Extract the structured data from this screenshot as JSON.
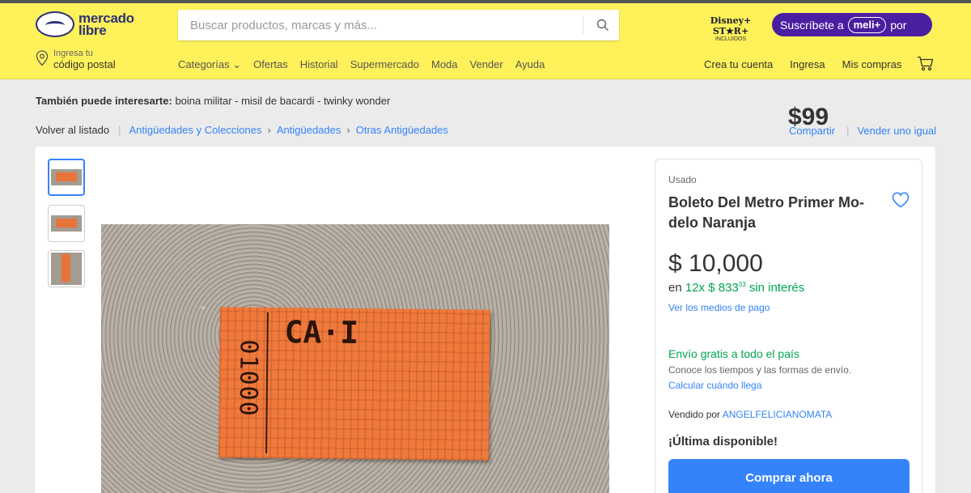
{
  "header": {
    "logo_text_line1": "mercado",
    "logo_text_line2": "libre",
    "search_placeholder": "Buscar productos, marcas y más...",
    "disney_line1": "Disney+ ST★R+",
    "disney_line2": "INCLUIDOS",
    "promo": {
      "prefix": "Suscríbete a",
      "badge": "meli+",
      "suffix": "por",
      "price": "$99"
    },
    "postal": {
      "line1": "Ingresa tu",
      "line2": "código postal"
    },
    "nav": [
      "Categorías ⌄",
      "Ofertas",
      "Historial",
      "Supermercado",
      "Moda",
      "Vender",
      "Ayuda"
    ],
    "account_nav": [
      "Crea tu cuenta",
      "Ingresa",
      "Mis compras"
    ]
  },
  "also_interested": {
    "label": "También puede interesarte:",
    "items": "boina militar - misil de bacardi - twinky wonder"
  },
  "breadcrumb": {
    "back": "Volver al listado",
    "items": [
      "Antigüedades y Colecciones",
      "Antigüedades",
      "Otras Antigüedades"
    ]
  },
  "actions": {
    "share": "Compartir",
    "sell_same": "Vender uno igual"
  },
  "gallery": {
    "ticket_code": "CA·I",
    "ticket_number": "01000"
  },
  "product": {
    "condition": "Usado",
    "title": "Boleto Del Metro Primer Mo-delo Naranja",
    "price": "$ 10,000",
    "installments_prefix": "en",
    "installments_green": "12x $ 833",
    "installments_cents": "33",
    "installments_suffix": "sin interés",
    "payment_link": "Ver los medios de pago",
    "shipping": "Envío gratis a todo el país",
    "shipping_sub": "Conoce los tiempos y las formas de envío.",
    "shipping_link": "Calcular cuándo llega",
    "seller_label": "Vendido por",
    "seller_name": "ANGELFELICIANOMATA",
    "stock": "¡Última disponible!",
    "buy_button": "Comprar ahora"
  },
  "colors": {
    "header_bg": "#fff159",
    "link_blue": "#3483fa",
    "green": "#00a650",
    "promo_purple": "#4a1ea1"
  }
}
